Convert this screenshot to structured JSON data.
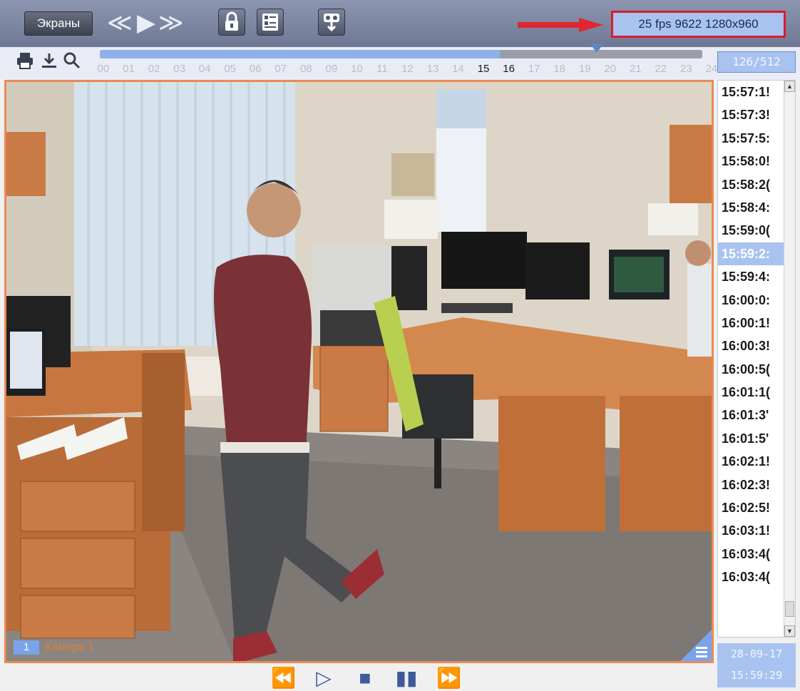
{
  "toolbar": {
    "screens_label": "Экраны",
    "icons": [
      "rewind-fast-icon",
      "play-icon",
      "forward-fast-icon",
      "lock-icon",
      "list-icon",
      "archive-export-icon"
    ],
    "fps_text": "25 fps   9622 1280x960"
  },
  "timeline": {
    "tools": [
      "print-icon",
      "download-icon",
      "search-icon"
    ],
    "hours": [
      "00",
      "01",
      "02",
      "03",
      "04",
      "05",
      "06",
      "07",
      "08",
      "09",
      "10",
      "11",
      "12",
      "13",
      "14",
      "15",
      "16",
      "17",
      "18",
      "19",
      "20",
      "21",
      "22",
      "23",
      "24"
    ],
    "highlighted_hours": [
      "15",
      "16"
    ],
    "counter": "126/512"
  },
  "video": {
    "camera_number": "1",
    "camera_name": "Камера 1"
  },
  "time_list": {
    "items": [
      "15:57:1!",
      "15:57:3!",
      "15:57:5:",
      "15:58:0!",
      "15:58:2(",
      "15:58:4:",
      "15:59:0(",
      "15:59:2:",
      "15:59:4:",
      "16:00:0:",
      "16:00:1!",
      "16:00:3!",
      "16:00:5(",
      "16:01:1(",
      "16:01:3'",
      "16:01:5'",
      "16:02:1!",
      "16:02:3!",
      "16:02:5!",
      "16:03:1!",
      "16:03:4(",
      "16:03:4("
    ],
    "selected_index": 7
  },
  "date_time": {
    "date": "28-09-17",
    "time": "15:59:29"
  },
  "playback": {
    "icons": [
      "step-back-icon",
      "play-icon",
      "stop-icon",
      "pause-icon",
      "step-forward-icon"
    ]
  },
  "colors": {
    "accent": "#a9c3f0",
    "frame": "#e98a55",
    "highlight_red": "#d81e2a"
  }
}
